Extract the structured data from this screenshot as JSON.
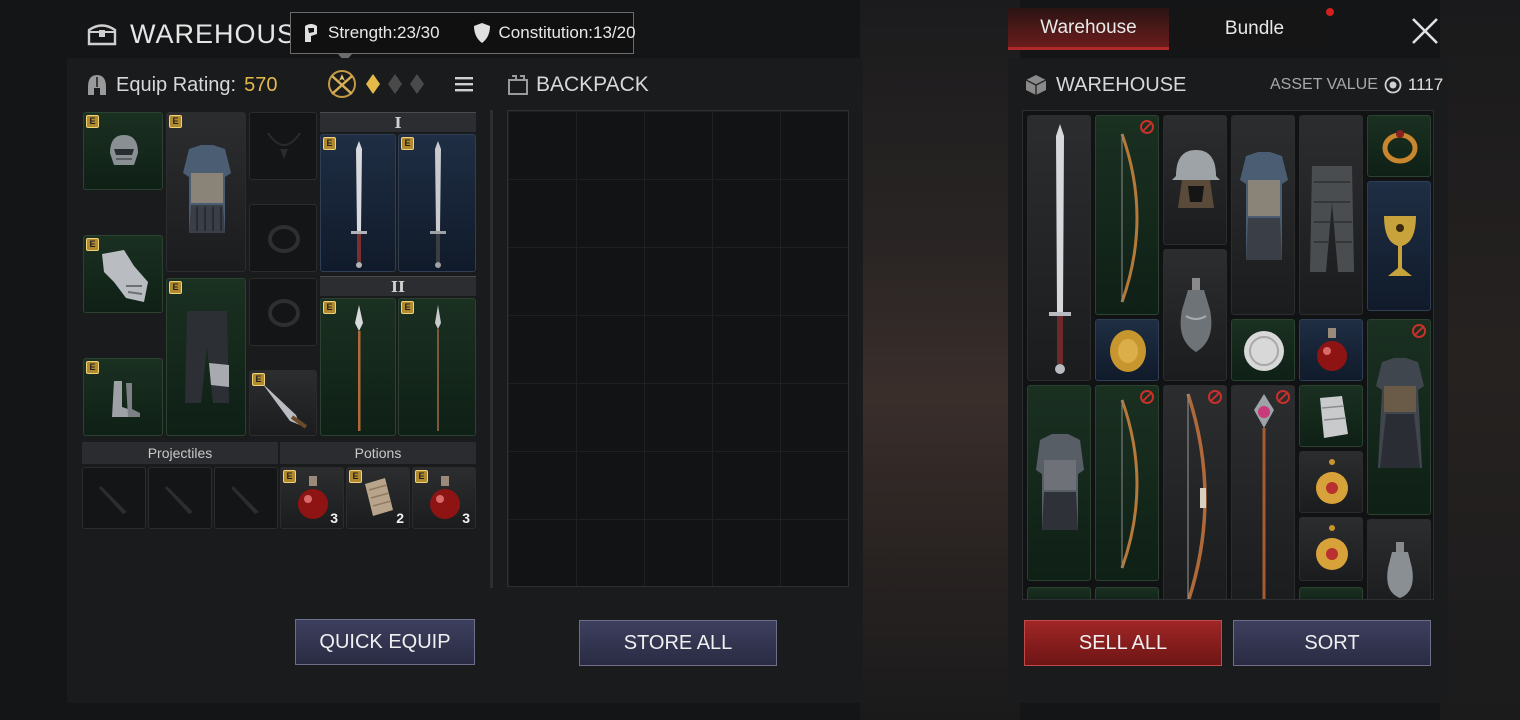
{
  "header": {
    "title": "WAREHOUSE",
    "strength": "Strength:23/30",
    "constitution": "Constitution:13/20"
  },
  "equipment": {
    "rating_label": "Equip Rating:",
    "rating_value": "570",
    "rank_icons": [
      "crest-icon",
      "diamond-filled",
      "diamond-empty",
      "diamond-empty"
    ],
    "weapon_set_1": "I",
    "weapon_set_2": "II",
    "projectiles_label": "Projectiles",
    "potions_label": "Potions",
    "slot_badge": "E",
    "potion_quantities": [
      "3",
      "2",
      "3"
    ],
    "quick_equip": "QUICK EQUIP"
  },
  "backpack": {
    "title": "BACKPACK",
    "store_all": "STORE ALL"
  },
  "warehouse": {
    "tabs": [
      "Warehouse",
      "Bundle"
    ],
    "active_tab": "Warehouse",
    "title": "WAREHOUSE",
    "asset_label": "ASSET VALUE",
    "asset_value": "1117",
    "sell_all": "SELL ALL",
    "sort": "SORT"
  },
  "colors": {
    "accent_gold": "#e3b94a",
    "tab_active": "#b0292a",
    "button_blue": "#3d3f5e",
    "button_red": "#a02626"
  }
}
